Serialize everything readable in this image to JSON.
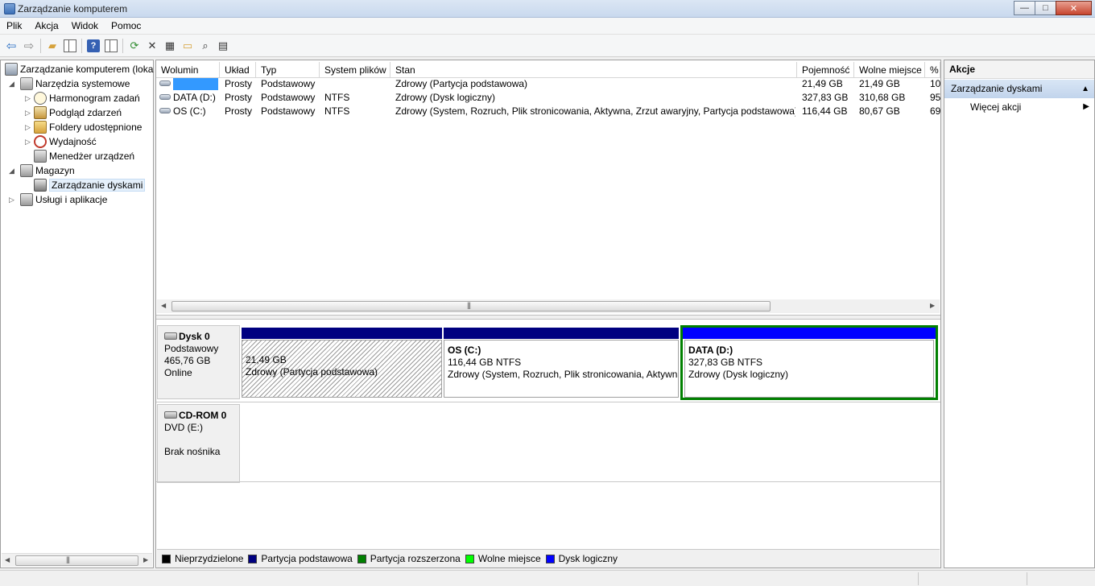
{
  "window": {
    "title": "Zarządzanie komputerem",
    "minimize": "—",
    "maximize": "□",
    "close": "✕"
  },
  "menu": [
    "Plik",
    "Akcja",
    "Widok",
    "Pomoc"
  ],
  "tree": {
    "root": "Zarządzanie komputerem (loka",
    "system_tools": "Narzędzia systemowe",
    "task_scheduler": "Harmonogram zadań",
    "event_viewer": "Podgląd zdarzeń",
    "shared_folders": "Foldery udostępnione",
    "performance": "Wydajność",
    "device_manager": "Menedżer urządzeń",
    "storage": "Magazyn",
    "disk_management": "Zarządzanie dyskami",
    "services_apps": "Usługi i aplikacje"
  },
  "columns": {
    "volume": "Wolumin",
    "layout": "Układ",
    "type": "Typ",
    "fs": "System plików",
    "status": "Stan",
    "capacity": "Pojemność",
    "free": "Wolne miejsce",
    "pct": "%"
  },
  "volumes": [
    {
      "name": "",
      "layout": "Prosty",
      "type": "Podstawowy",
      "fs": "",
      "status": "Zdrowy (Partycja podstawowa)",
      "capacity": "21,49 GB",
      "free": "21,49 GB",
      "pct": "10"
    },
    {
      "name": "DATA (D:)",
      "layout": "Prosty",
      "type": "Podstawowy",
      "fs": "NTFS",
      "status": "Zdrowy (Dysk logiczny)",
      "capacity": "327,83 GB",
      "free": "310,68 GB",
      "pct": "95"
    },
    {
      "name": "OS (C:)",
      "layout": "Prosty",
      "type": "Podstawowy",
      "fs": "NTFS",
      "status": "Zdrowy (System, Rozruch, Plik stronicowania, Aktywna, Zrzut awaryjny, Partycja podstawowa)",
      "capacity": "116,44 GB",
      "free": "80,67 GB",
      "pct": "69"
    }
  ],
  "disk0": {
    "name": "Dysk 0",
    "type": "Podstawowy",
    "size": "465,76 GB",
    "state": "Online",
    "p1": {
      "size": "21,49 GB",
      "status": "Zdrowy (Partycja podstawowa)"
    },
    "p2": {
      "name": "OS  (C:)",
      "size": "116,44 GB NTFS",
      "status": "Zdrowy (System, Rozruch, Plik stronicowania, Aktywna, Zrzut awaryjny, Partycja podstawowa)"
    },
    "p3": {
      "name": "DATA  (D:)",
      "size": "327,83 GB NTFS",
      "status": "Zdrowy (Dysk logiczny)"
    }
  },
  "cdrom": {
    "name": "CD-ROM 0",
    "drive": "DVD (E:)",
    "state": "Brak nośnika"
  },
  "legend": [
    {
      "label": "Nieprzydzielone",
      "color": "#000000"
    },
    {
      "label": "Partycja podstawowa",
      "color": "#000080"
    },
    {
      "label": "Partycja rozszerzona",
      "color": "#008000"
    },
    {
      "label": "Wolne miejsce",
      "color": "#00ff00"
    },
    {
      "label": "Dysk logiczny",
      "color": "#0000ff"
    }
  ],
  "actions": {
    "header": "Akcje",
    "section": "Zarządzanie dyskami",
    "more": "Więcej akcji"
  },
  "colors": {
    "primary_partition": "#000080",
    "logical_drive": "#0000ff",
    "selected_border": "#008000",
    "selection": "#3399ff"
  }
}
